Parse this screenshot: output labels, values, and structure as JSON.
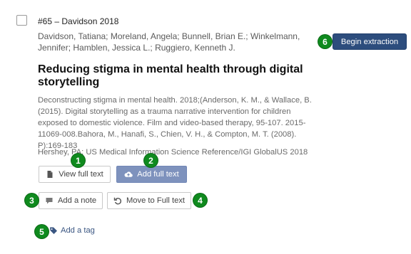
{
  "record": {
    "id_label": "#65 – Davidson 2018",
    "authors": "Davidson, Tatiana; Moreland, Angela; Bunnell, Brian E.; Winkelmann, Jennifer; Hamblen, Jessica L.; Ruggiero, Kenneth J.",
    "title": "Reducing stigma in mental health through digital storytelling",
    "abstract": "Deconstructing stigma in mental health. 2018;(Anderson, K. M., & Wallace, B. (2015). Digital storytelling as a trauma narrative intervention for children exposed to domestic violence. Film and video-based therapy, 95-107. 2015-11069-008.Bahora, M., Hanafi, S., Chien, V. H., & Compton, M. T. (2008). P):169-183",
    "source": "Hershey, PA: US Medical Information Science Reference/IGI GlobalUS 2018"
  },
  "actions": {
    "begin_extraction": "Begin extraction",
    "view_full_text": "View full text",
    "add_full_text": "Add full text",
    "add_note": "Add a note",
    "move_to_full_text": "Move to Full text",
    "add_tag": "Add a tag"
  },
  "callouts": [
    "1",
    "2",
    "3",
    "4",
    "5",
    "6"
  ],
  "icons": {
    "view_full_text": "file-icon",
    "add_full_text": "cloud-upload-icon",
    "add_note": "comment-icon",
    "move_to_full_text": "undo-icon",
    "add_tag": "tag-icon"
  },
  "colors": {
    "primary_button": "#7e92bd",
    "extraction_button": "#2d4d7d",
    "callout_badge": "#0f8a1e",
    "link": "#3a5682"
  }
}
